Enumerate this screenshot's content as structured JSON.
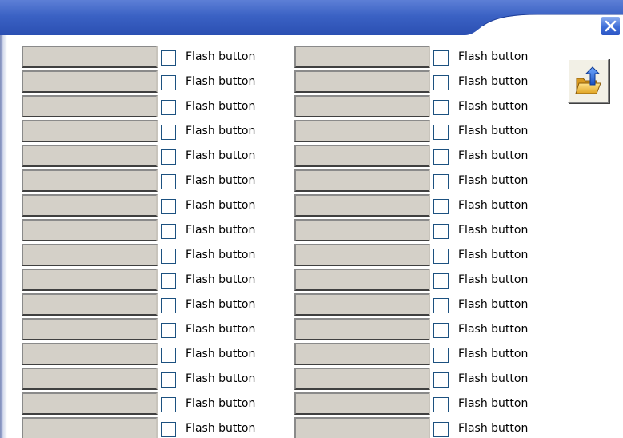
{
  "window": {
    "close_icon": "close-x-icon",
    "titlebar_color": "#3a64c8"
  },
  "flash_label": "Flash button",
  "toolbar": {
    "open_icon": "open-folder-up-arrow-icon"
  },
  "colors": {
    "swatch": "#d4d0c8",
    "checkbox_border": "#1c5180"
  },
  "rows_per_column": 16,
  "columns": 2
}
